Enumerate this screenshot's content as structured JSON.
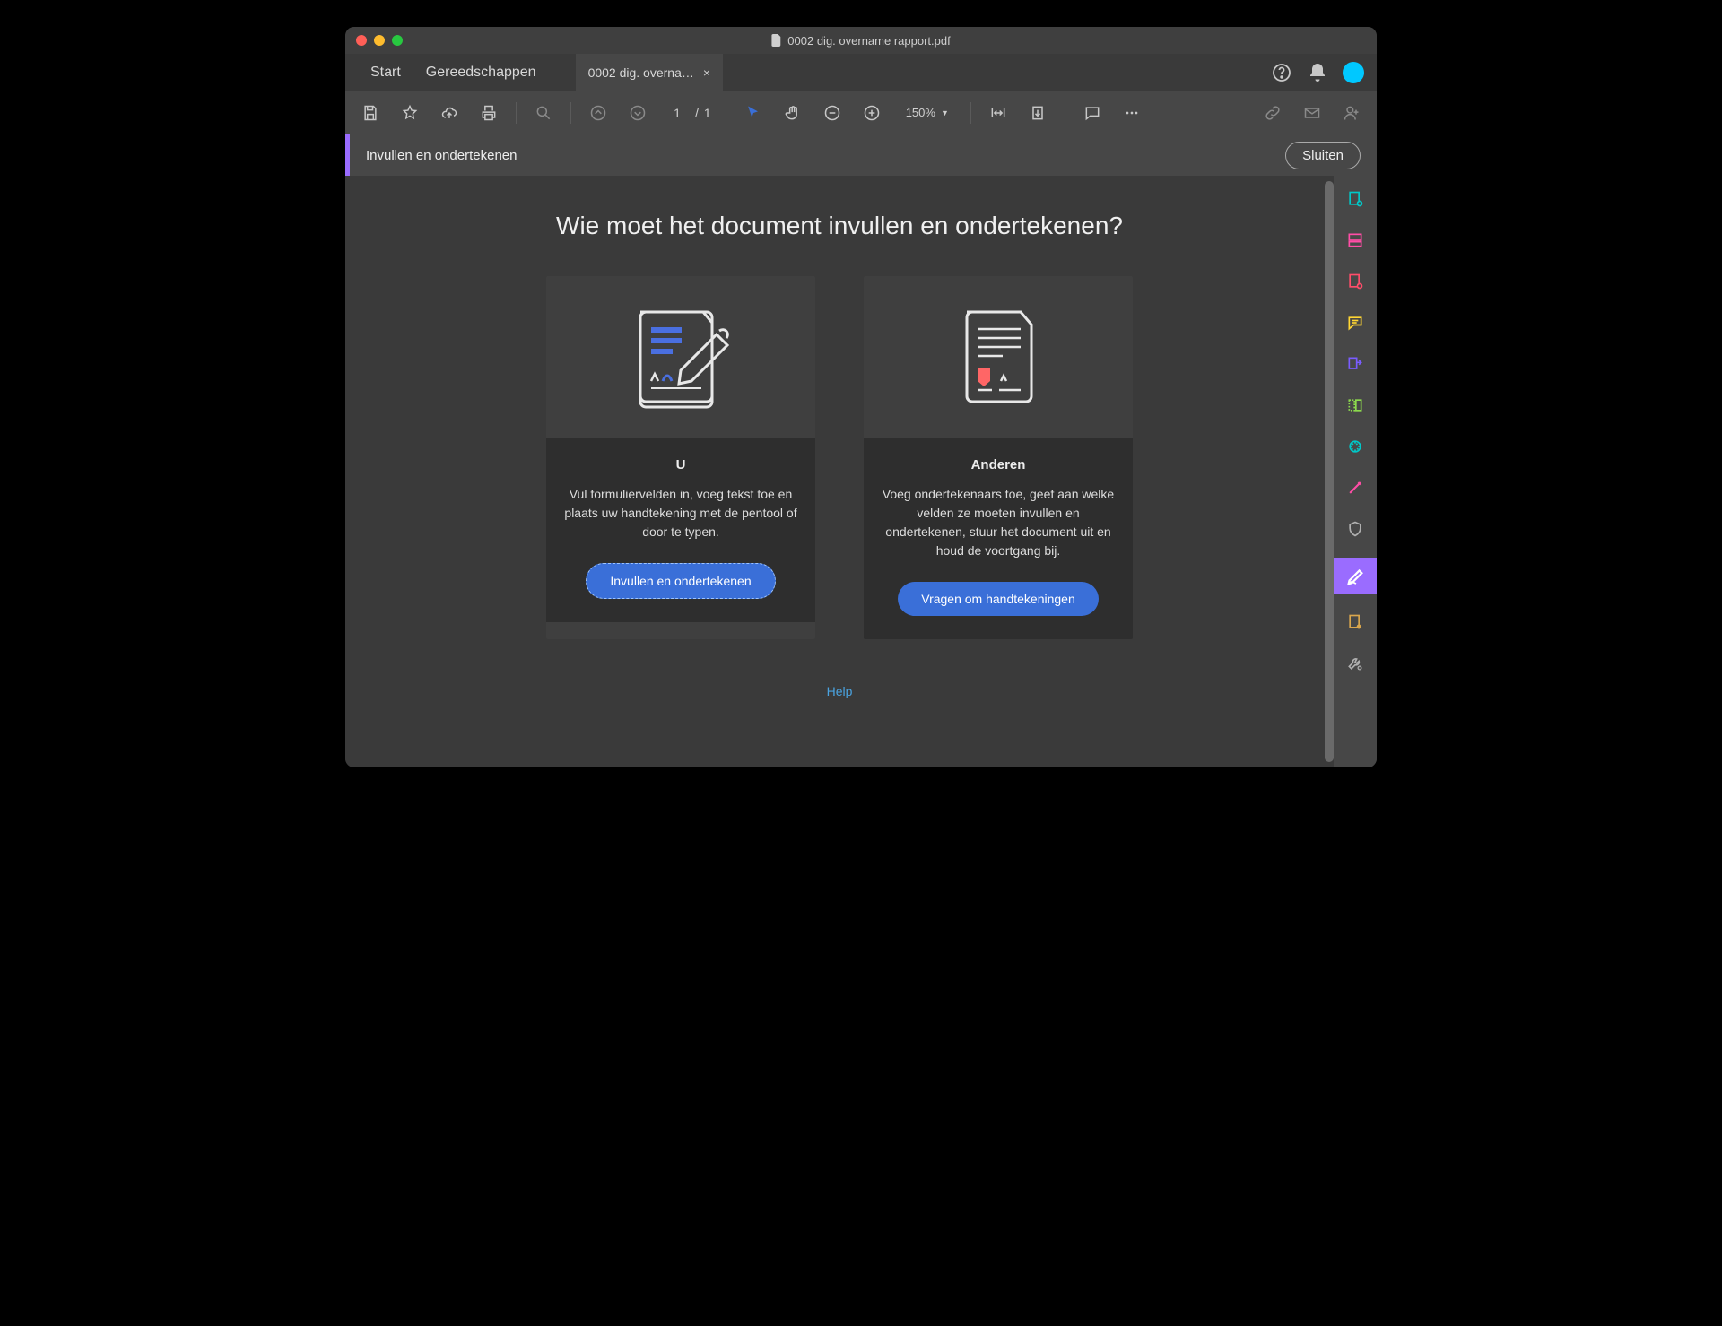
{
  "window": {
    "title": "0002 dig. overname rapport.pdf"
  },
  "nav": {
    "start": "Start",
    "tools": "Gereedschappen",
    "filetab": "0002 dig. overna…"
  },
  "toolbar": {
    "page_current": "1",
    "page_sep": "/",
    "page_total": "1",
    "zoom": "150%"
  },
  "subbar": {
    "label": "Invullen en ondertekenen",
    "close": "Sluiten"
  },
  "main": {
    "question": "Wie moet het document invullen en ondertekenen?",
    "card_you": {
      "title": "U",
      "desc": "Vul formuliervelden in, voeg tekst toe en plaats uw handtekening met de pentool of door te typen.",
      "button": "Invullen en ondertekenen"
    },
    "card_others": {
      "title": "Anderen",
      "desc": "Voeg ondertekenaars toe, geef aan welke velden ze moeten invullen en ondertekenen, stuur het document uit en houd de voortgang bij.",
      "button": "Vragen om handtekeningen"
    },
    "help": "Help"
  },
  "colors": {
    "accent": "#9a6cff",
    "blue": "#3a6fd8",
    "avatar": "#00c8ff"
  }
}
